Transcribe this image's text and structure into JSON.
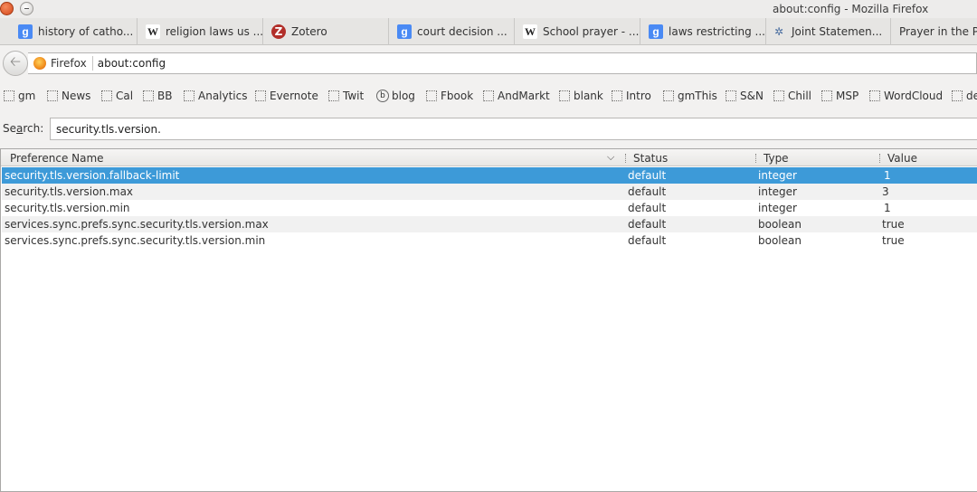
{
  "window": {
    "title": "about:config - Mozilla Firefox"
  },
  "tabs": [
    {
      "label": "history of catho...",
      "icon": "google-icon"
    },
    {
      "label": "religion laws us ...",
      "icon": "wikipedia-icon"
    },
    {
      "label": "Zotero",
      "icon": "zotero-icon"
    },
    {
      "label": "court decision ...",
      "icon": "google-icon"
    },
    {
      "label": "School prayer - ...",
      "icon": "wikipedia-icon"
    },
    {
      "label": "laws restricting ...",
      "icon": "google-icon"
    },
    {
      "label": "Joint Statemen...",
      "icon": "statue-icon"
    },
    {
      "label": "Prayer in the Pu",
      "icon": "none"
    }
  ],
  "navbar": {
    "identity_label": "Firefox",
    "url": "about:config"
  },
  "bookmarks": [
    "gm",
    "News",
    "Cal",
    "BB",
    "Analytics",
    "Evernote",
    "Twit",
    "blog",
    "Fbook",
    "AndMarkt",
    "blank",
    "Intro",
    "gmThis",
    "S&N",
    "Chill",
    "MSP",
    "WordCloud",
    "de"
  ],
  "search": {
    "label_prefix": "Se",
    "label_accel": "a",
    "label_suffix": "rch:",
    "value": "security.tls.version."
  },
  "table": {
    "headers": {
      "name": "Preference Name",
      "status": "Status",
      "type": "Type",
      "value": "Value"
    },
    "rows": [
      {
        "name": "security.tls.version.fallback-limit",
        "status": "default",
        "type": "integer",
        "value": "1",
        "selected": true
      },
      {
        "name": "security.tls.version.max",
        "status": "default",
        "type": "integer",
        "value": "3"
      },
      {
        "name": "security.tls.version.min",
        "status": "default",
        "type": "integer",
        "value": "1"
      },
      {
        "name": "services.sync.prefs.sync.security.tls.version.max",
        "status": "default",
        "type": "boolean",
        "value": "true"
      },
      {
        "name": "services.sync.prefs.sync.security.tls.version.min",
        "status": "default",
        "type": "boolean",
        "value": "true"
      }
    ]
  },
  "colors": {
    "selection": "#3d9ad8",
    "alt_row": "#f1f1f1"
  }
}
